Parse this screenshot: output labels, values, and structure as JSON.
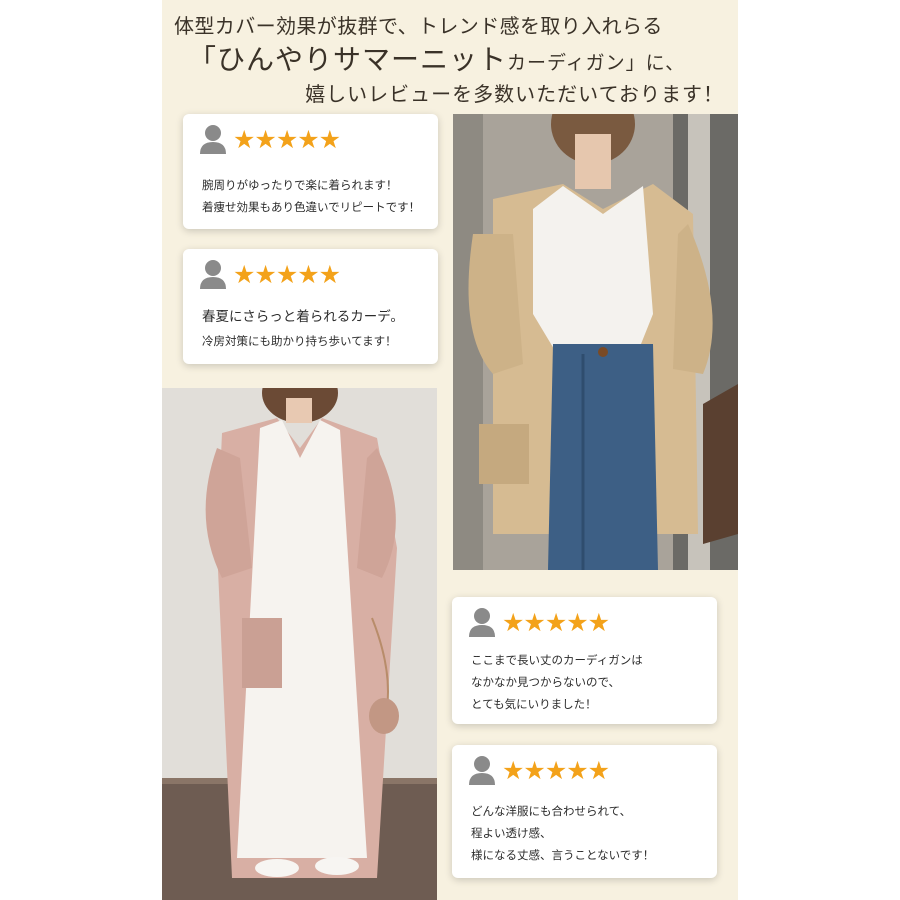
{
  "headline": {
    "line1": "体型カバー効果が抜群で、トレンド感を取り入れらる",
    "line2_main": "「ひんやりサマーニット",
    "line2_small": "カーディガン」に、",
    "line3": "嬉しいレビューを多数いただいております！"
  },
  "reviews": [
    {
      "stars": "★★★★★",
      "lines": [
        "腕周りがゆったりで楽に着られます！",
        "着痩せ効果もあり色違いでリピートです！"
      ]
    },
    {
      "stars": "★★★★★",
      "lines": [
        "春夏にさらっと着られるカーデ。",
        "冷房対策にも助かり持ち歩いてます！"
      ]
    },
    {
      "stars": "★★★★★",
      "lines": [
        "ここまで長い丈のカーディガンは",
        "なかなか見つからないので、",
        "とても気にいりました！"
      ]
    },
    {
      "stars": "★★★★★",
      "lines": [
        "どんな洋服にも合わせられて、",
        "程よい透け感、",
        "様になる丈感、言うことないです！"
      ]
    }
  ],
  "colors": {
    "panel_bg": "#f7f1e0",
    "star": "#f3a21a",
    "avatar": "#8a8a8a"
  },
  "icons": {
    "avatar": "user-silhouette-icon"
  }
}
